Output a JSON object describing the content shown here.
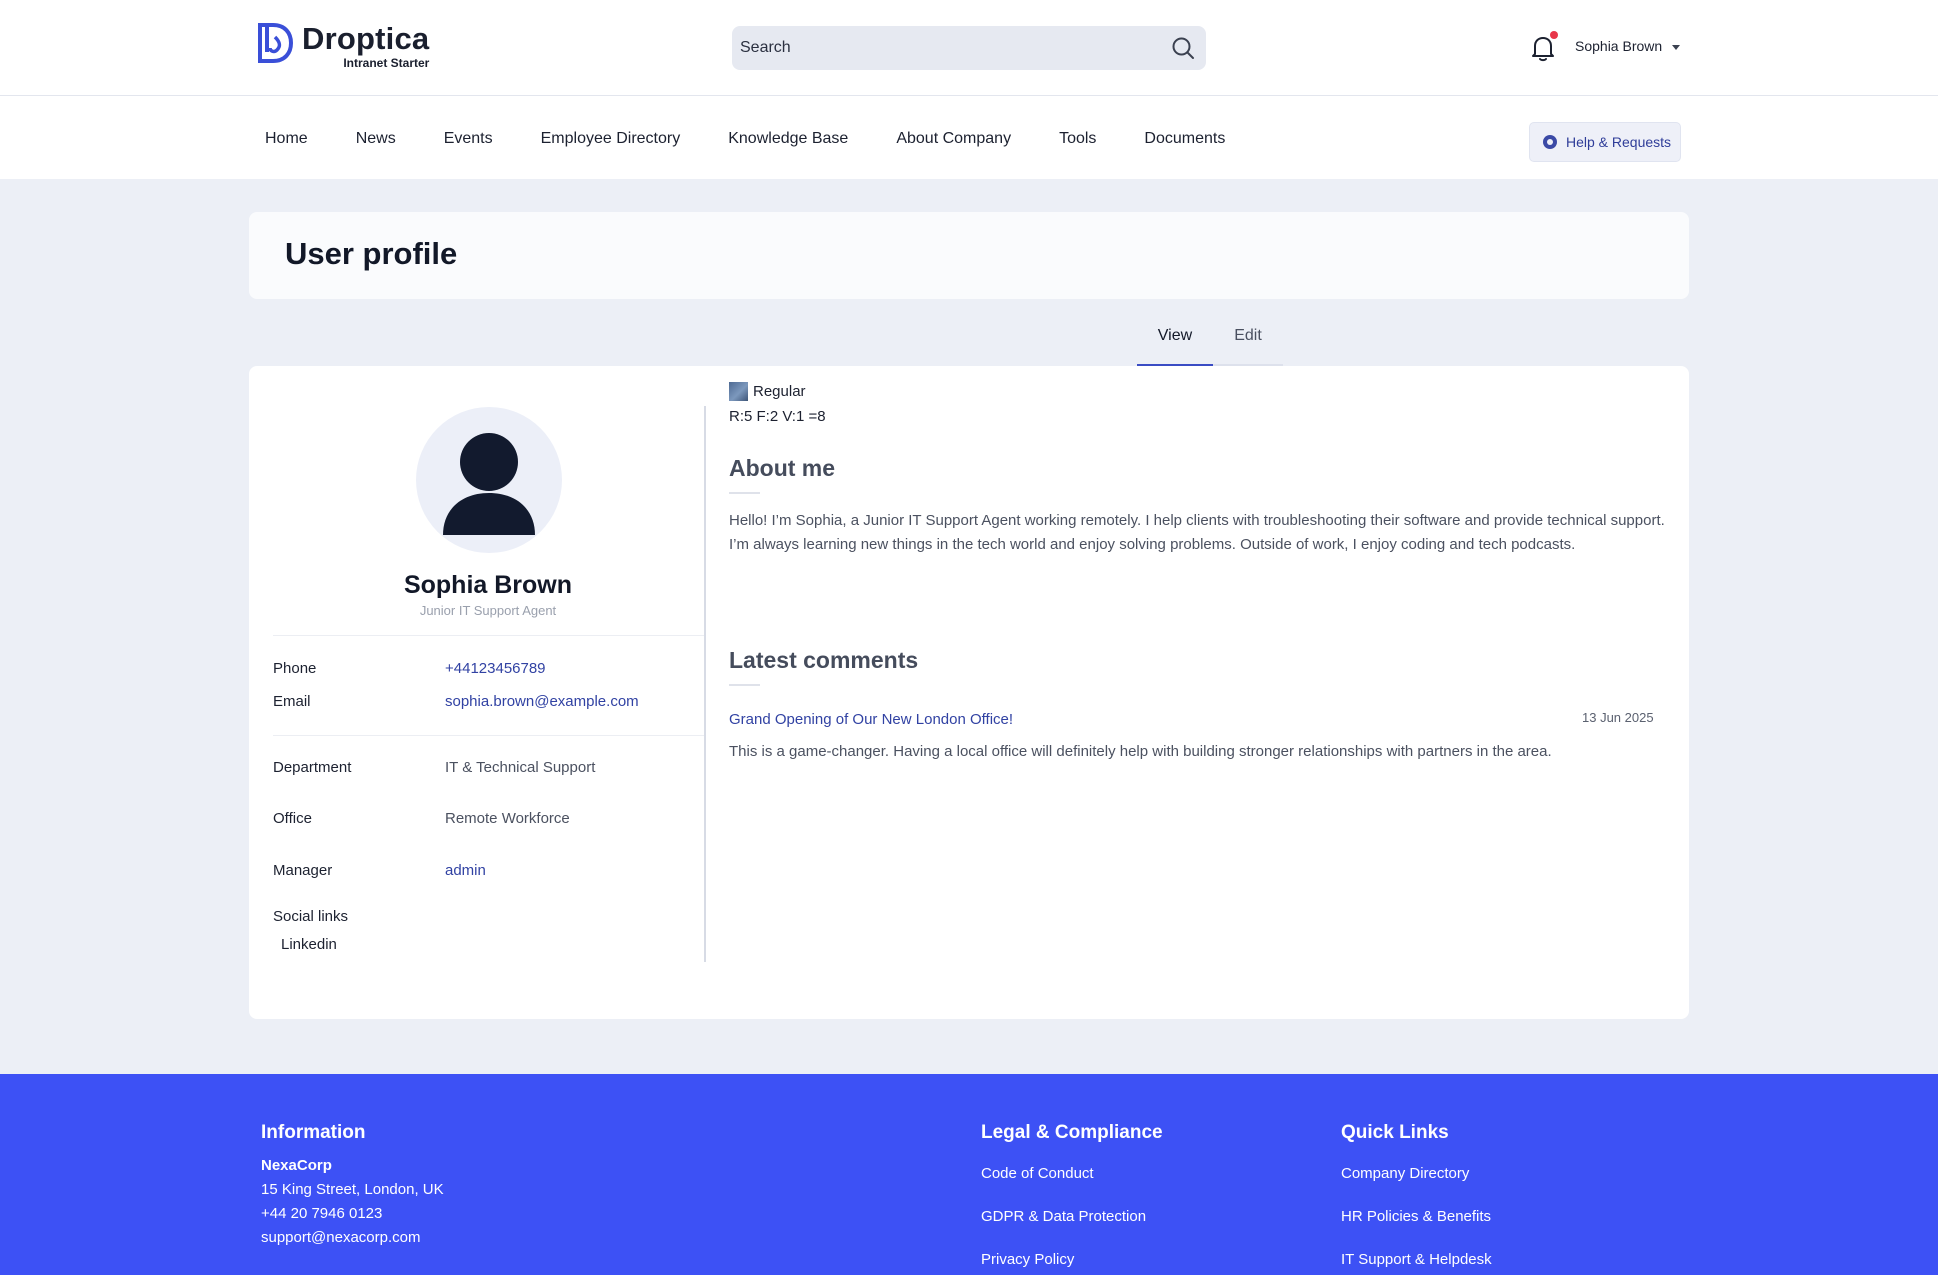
{
  "brand": {
    "name": "Droptica",
    "subtitle": "Intranet Starter",
    "accent": "#3d51f5"
  },
  "search": {
    "placeholder": "Search"
  },
  "user": {
    "name": "Sophia Brown",
    "notification_dot": "#e8364a"
  },
  "nav": {
    "items": [
      {
        "label": "Home"
      },
      {
        "label": "News"
      },
      {
        "label": "Events"
      },
      {
        "label": "Employee Directory"
      },
      {
        "label": "Knowledge Base"
      },
      {
        "label": "About Company"
      },
      {
        "label": "Tools"
      },
      {
        "label": "Documents"
      }
    ],
    "help_label": "Help & Requests"
  },
  "page": {
    "title": "User profile"
  },
  "tabs": {
    "view": "View",
    "edit": "Edit",
    "active": "View"
  },
  "profile": {
    "name": "Sophia Brown",
    "role": "Junior IT Support Agent",
    "phone_label": "Phone",
    "phone": "+44123456789",
    "email_label": "Email",
    "email": "sophia.brown@example.com",
    "department_label": "Department",
    "department": "IT & Technical Support",
    "office_label": "Office",
    "office": "Remote Workforce",
    "manager_label": "Manager",
    "manager": "admin",
    "social_label": "Social links",
    "social_items": [
      "Linkedin"
    ]
  },
  "rank": {
    "badge": "Regular",
    "stats": "R:5 F:2 V:1 =8"
  },
  "about": {
    "title": "About me",
    "text": "Hello! I’m Sophia, a Junior IT Support Agent working remotely. I help clients with troubleshooting their software and provide technical support. I’m always learning new things in the tech world and enjoy solving problems. Outside of work, I enjoy coding and tech podcasts."
  },
  "comments": {
    "title": "Latest comments",
    "items": [
      {
        "title": "Grand Opening of Our New London Office!",
        "date": "13 Jun 2025",
        "body": "This is a game-changer. Having a local office will definitely help with building stronger relationships with partners in the area."
      }
    ]
  },
  "footer": {
    "info_title": "Information",
    "company": "NexaCorp",
    "address": "15 King Street, London, UK",
    "phone": "+44 20 7946 0123",
    "email": "support@nexacorp.com",
    "legal_title": "Legal & Compliance",
    "legal_links": [
      "Code of Conduct",
      "GDPR & Data Protection",
      "Privacy Policy"
    ],
    "quick_title": "Quick Links",
    "quick_links": [
      "Company Directory",
      "HR Policies & Benefits",
      "IT Support & Helpdesk"
    ]
  }
}
